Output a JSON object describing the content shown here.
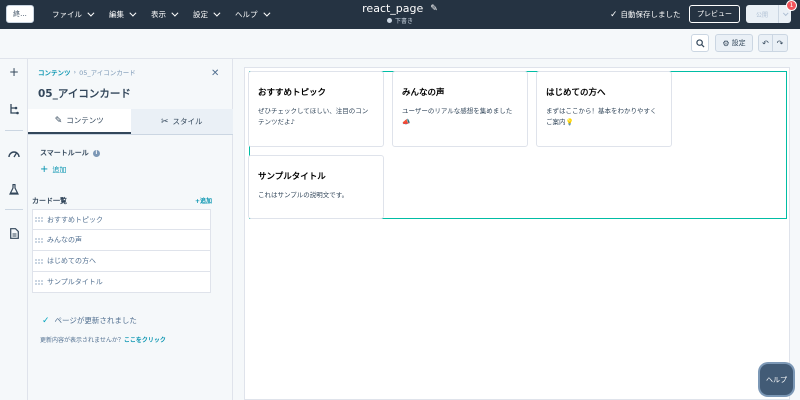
{
  "topbar": {
    "exit_label": "終...",
    "menus": [
      "ファイル",
      "編集",
      "表示",
      "設定",
      "ヘルプ"
    ],
    "page_title": "react_page",
    "page_status": "下書き",
    "autosave": "自動保存しました",
    "preview_label": "プレビュー",
    "publish_label": "公開",
    "notification_count": "1"
  },
  "toolbar": {
    "settings_label": "設定"
  },
  "panel": {
    "breadcrumb_root": "コンテンツ",
    "breadcrumb_sep": "›",
    "breadcrumb_current": "05_アイコンカード",
    "title": "05_アイコンカード",
    "tabs": [
      {
        "label": "コンテンツ",
        "icon": "pencil-icon",
        "active": true
      },
      {
        "label": "スタイル",
        "icon": "brush-icon",
        "active": false
      }
    ],
    "smart_rule_label": "スマートルール",
    "smart_rule_add": "追加",
    "list_label": "カード一覧",
    "list_add": "+追加",
    "list_items": [
      "おすすめトピック",
      "みんなの声",
      "はじめての方へ",
      "サンプルタイトル"
    ],
    "updated_message": "ページが更新されました",
    "not_shown_prefix": "更新内容が表示されませんか？",
    "click_here": "ここをクリック"
  },
  "cards": [
    {
      "title": "おすすめトピック",
      "text": "ぜひチェックしてほしい、注目のコンテンツだよ♪"
    },
    {
      "title": "みんなの声",
      "text": "ユーザーのリアルな感想を集めました📣"
    },
    {
      "title": "はじめての方へ",
      "text": "まずはここから！基本をわかりやすくご案内💡"
    },
    {
      "title": "サンプルタイトル",
      "text": "これはサンプルの説明文です。"
    }
  ],
  "help_label": "ヘルプ",
  "colors": {
    "topbar_bg": "#253342",
    "accent": "#0091ae",
    "section_outline": "#00bda5",
    "badge": "#f2545b"
  }
}
